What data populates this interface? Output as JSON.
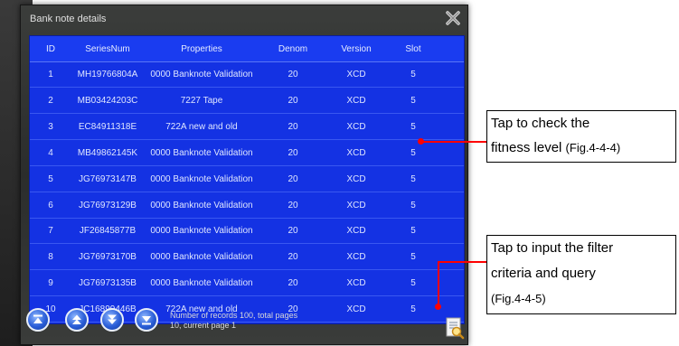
{
  "window": {
    "title": "Bank note details"
  },
  "table": {
    "headers": {
      "id": "ID",
      "serial": "SeriesNum",
      "properties": "Properties",
      "denom": "Denom",
      "version": "Version",
      "slot": "Slot"
    },
    "rows": [
      {
        "id": "1",
        "serial": "MH19766804A",
        "properties": "0000 Banknote Validation",
        "denom": "20",
        "version": "XCD",
        "slot": "5"
      },
      {
        "id": "2",
        "serial": "MB03424203C",
        "properties": "7227 Tape",
        "denom": "20",
        "version": "XCD",
        "slot": "5"
      },
      {
        "id": "3",
        "serial": "EC84911318E",
        "properties": "722A new and old",
        "denom": "20",
        "version": "XCD",
        "slot": "5"
      },
      {
        "id": "4",
        "serial": "MB49862145K",
        "properties": "0000 Banknote Validation",
        "denom": "20",
        "version": "XCD",
        "slot": "5"
      },
      {
        "id": "5",
        "serial": "JG76973147B",
        "properties": "0000 Banknote Validation",
        "denom": "20",
        "version": "XCD",
        "slot": "5"
      },
      {
        "id": "6",
        "serial": "JG76973129B",
        "properties": "0000 Banknote Validation",
        "denom": "20",
        "version": "XCD",
        "slot": "5"
      },
      {
        "id": "7",
        "serial": "JF26845877B",
        "properties": "0000 Banknote Validation",
        "denom": "20",
        "version": "XCD",
        "slot": "5"
      },
      {
        "id": "8",
        "serial": "JG76973170B",
        "properties": "0000 Banknote Validation",
        "denom": "20",
        "version": "XCD",
        "slot": "5"
      },
      {
        "id": "9",
        "serial": "JG76973135B",
        "properties": "0000 Banknote Validation",
        "denom": "20",
        "version": "XCD",
        "slot": "5"
      },
      {
        "id": "10",
        "serial": "JC16899446B",
        "properties": "722A new and old",
        "denom": "20",
        "version": "XCD",
        "slot": "5"
      }
    ]
  },
  "footer": {
    "records_line1": "Number of records 100, total pages",
    "records_line2": "10, current page 1",
    "buttons": [
      "first-page-icon",
      "previous-page-icon",
      "next-page-icon",
      "last-page-icon"
    ],
    "filter_icon": "filter-query-icon"
  },
  "callouts": {
    "fitness_line1": "Tap to check the",
    "fitness_line2": "fitness level",
    "fitness_ref": "(Fig.4-4-4)",
    "filter_line1": "Tap to input the filter",
    "filter_line2": "criteria and query",
    "filter_ref": "(Fig.4-4-5)"
  },
  "colors": {
    "grid": "#1432e3",
    "callout_line": "#ff0000",
    "window": "#2e302f"
  }
}
